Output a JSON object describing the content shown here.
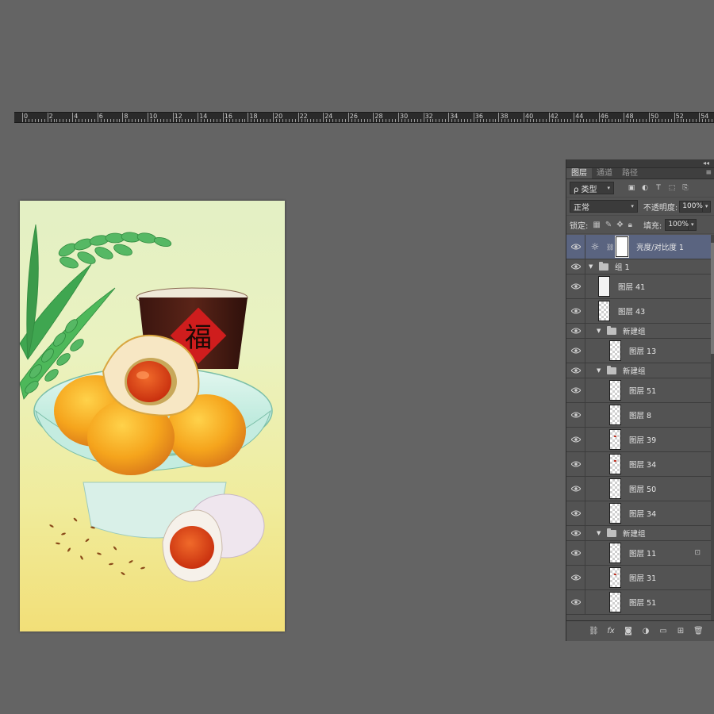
{
  "ruler": {
    "labels": [
      "0",
      "2",
      "4",
      "6",
      "8",
      "10",
      "12",
      "14",
      "16",
      "18",
      "20",
      "22",
      "24",
      "26",
      "28",
      "30",
      "32",
      "34",
      "36",
      "38",
      "40",
      "42",
      "44",
      "46",
      "48",
      "50",
      "52",
      "54"
    ]
  },
  "artwork": {
    "fu_character": "福",
    "colors": {
      "background_top": "#e3f0c4",
      "background_bottom": "#f2df78",
      "plate": "#bfeee0",
      "cake": "#f5a41c",
      "yolk": "#e0401a",
      "cup": "#4a1e16",
      "wheat": "#4db85a"
    }
  },
  "panel": {
    "collapse_icon": "double-chevron-left-icon",
    "tabs": [
      {
        "label": "图层",
        "active": true
      },
      {
        "label": "通道",
        "active": false
      },
      {
        "label": "路径",
        "active": false
      }
    ],
    "filter": {
      "label": "ρ 类型"
    },
    "blend_mode": "正常",
    "opacity_label": "不透明度:",
    "opacity_value": "100%",
    "lock_label": "锁定:",
    "fill_label": "填充:",
    "fill_value": "100%",
    "layers": [
      {
        "name": "亮度/对比度 1",
        "kind": "adjustment",
        "selected": true
      },
      {
        "name": "组 1",
        "kind": "group",
        "indent": 0
      },
      {
        "name": "图层 41",
        "kind": "layer",
        "indent": 1,
        "thumb": "light"
      },
      {
        "name": "图层 43",
        "kind": "layer",
        "indent": 1,
        "thumb": "checker"
      },
      {
        "name": "新建组",
        "kind": "group",
        "indent": 1
      },
      {
        "name": "图层 13",
        "kind": "layer",
        "indent": 2,
        "thumb": "checker"
      },
      {
        "name": "新建组",
        "kind": "group",
        "indent": 1
      },
      {
        "name": "图层 51",
        "kind": "layer",
        "indent": 2,
        "thumb": "checker"
      },
      {
        "name": "图层 8",
        "kind": "layer",
        "indent": 2,
        "thumb": "checker"
      },
      {
        "name": "图层 39",
        "kind": "layer",
        "indent": 2,
        "thumb": "dot"
      },
      {
        "name": "图层 34",
        "kind": "layer",
        "indent": 2,
        "thumb": "dot"
      },
      {
        "name": "图层 50",
        "kind": "layer",
        "indent": 2,
        "thumb": "checker"
      },
      {
        "name": "图层 34",
        "kind": "layer",
        "indent": 2,
        "thumb": "checker"
      },
      {
        "name": "新建组",
        "kind": "group",
        "indent": 1
      },
      {
        "name": "图层 11",
        "kind": "layer",
        "indent": 2,
        "thumb": "checker",
        "locked": true
      },
      {
        "name": "图层 31",
        "kind": "layer",
        "indent": 2,
        "thumb": "dot"
      },
      {
        "name": "图层 51",
        "kind": "layer",
        "indent": 2,
        "thumb": "checker"
      }
    ]
  }
}
